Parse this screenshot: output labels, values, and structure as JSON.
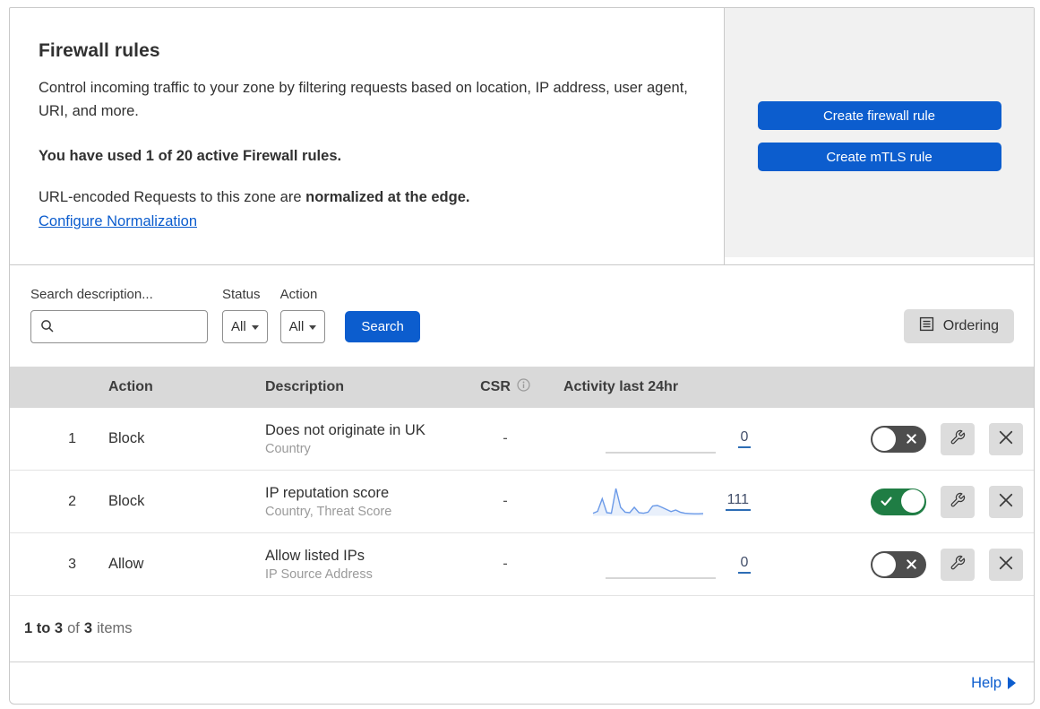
{
  "header": {
    "title": "Firewall rules",
    "description": "Control incoming traffic to your zone by filtering requests based on location, IP address, user agent, URI, and more.",
    "usage": "You have used 1 of 20 active Firewall rules.",
    "normalization_text": "URL-encoded Requests to this zone are",
    "normalization_bold": "normalized at the edge.",
    "normalization_link": "Configure Normalization",
    "buttons": [
      {
        "label": "Create firewall rule"
      },
      {
        "label": "Create mTLS rule"
      }
    ]
  },
  "filters": {
    "search_label": "Search description...",
    "status_label": "Status",
    "status_value": "All",
    "action_label": "Action",
    "action_value": "All",
    "search_button": "Search",
    "ordering_button": "Ordering"
  },
  "table": {
    "columns": {
      "action": "Action",
      "description": "Description",
      "csr": "CSR",
      "activity": "Activity last 24hr"
    },
    "rows": [
      {
        "priority": "1",
        "action": "Block",
        "description": "Does not originate in UK",
        "criteria": "Country",
        "csr": "-",
        "activity_count": "0",
        "enabled": false,
        "sparkline": null
      },
      {
        "priority": "2",
        "action": "Block",
        "description": "IP reputation score",
        "criteria": "Country, Threat Score",
        "csr": "-",
        "activity_count": "111",
        "enabled": true,
        "sparkline": [
          8,
          15,
          62,
          10,
          8,
          100,
          30,
          12,
          10,
          30,
          10,
          8,
          12,
          35,
          37,
          30,
          22,
          14,
          20,
          12,
          8,
          7,
          6,
          6,
          7
        ]
      },
      {
        "priority": "3",
        "action": "Allow",
        "description": "Allow listed IPs",
        "criteria": "IP Source Address",
        "csr": "-",
        "activity_count": "0",
        "enabled": false,
        "sparkline": null
      }
    ]
  },
  "footer": {
    "range": "1 to 3",
    "of": "of",
    "total": "3",
    "items": "items",
    "help_label": "Help"
  },
  "colors": {
    "accent_blue": "#0c5dce",
    "toggle_on_green": "#1f7d44",
    "toggle_off_gray": "#4d4d4d",
    "table_header_gray": "#d9d9d9",
    "panel_gray": "#f1f1f1",
    "sparkline_blue": "#6b9ae8"
  }
}
